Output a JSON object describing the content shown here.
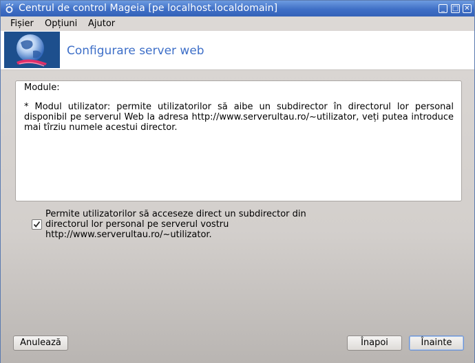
{
  "window": {
    "title": "Centrul de control Mageia  [pe localhost.localdomain]",
    "controls": {
      "minimize": "_",
      "maximize": "□",
      "close": "✕"
    }
  },
  "menubar": {
    "items": [
      "Fișier",
      "Opțiuni",
      "Ajutor"
    ]
  },
  "header": {
    "title": "Configurare server web",
    "logo_icon": "mageia-globe-icon"
  },
  "info": {
    "heading": "Module:",
    "body": "* Modul utilizator: permite utilizatorilor să aibe un subdirector în directorul lor personal disponibil pe serverul Web la adresa http://www.serverultau.ro/~utilizator, veți putea introduce mai tîrziu numele acestui director."
  },
  "option": {
    "checked": true,
    "label": "Permite utilizatorilor să acceseze direct un subdirector din directorul lor personal pe serverul vostru http://www.serverultau.ro/~utilizator."
  },
  "buttons": {
    "cancel": "Anulează",
    "back": "Înapoi",
    "next": "Înainte"
  },
  "colors": {
    "titlebar": "#3f6fc6",
    "accent": "#3e6fc8",
    "logo_bg": "#1d4f8d"
  }
}
